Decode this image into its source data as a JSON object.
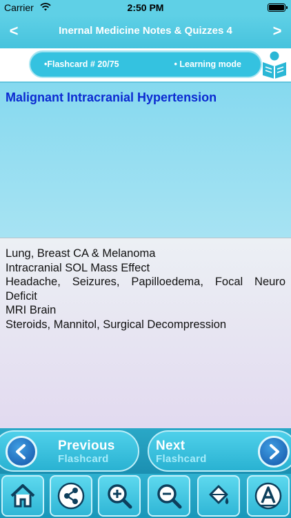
{
  "status_bar": {
    "carrier": "Carrier",
    "time": "2:50 PM"
  },
  "header": {
    "title": "Inernal Medicine Notes & Quizzes 4",
    "back_label": "<",
    "forward_label": ">"
  },
  "info_bar": {
    "flashcard_label": "•Flashcard #  20/75",
    "mode_label": "• Learning mode"
  },
  "question": {
    "text": "Malignant Intracranial Hypertension"
  },
  "answer": {
    "lines": [
      "Lung, Breast CA & Melanoma",
      "Intracranial SOL Mass Effect",
      "Headache, Seizures, Papilloedema, Focal Neuro Deficit",
      "MRI Brain",
      "Steroids, Mannitol, Surgical Decompression"
    ]
  },
  "nav_buttons": {
    "previous": {
      "line1": "Previous",
      "line2": "Flashcard"
    },
    "next": {
      "line1": "Next",
      "line2": "Flashcard"
    }
  },
  "toolbar": {
    "items": [
      {
        "icon": "home-icon"
      },
      {
        "icon": "share-icon"
      },
      {
        "icon": "zoom-in-icon"
      },
      {
        "icon": "zoom-out-icon"
      },
      {
        "icon": "paint-bucket-icon"
      },
      {
        "icon": "font-icon"
      }
    ]
  },
  "colors": {
    "accent": "#46c3dd",
    "question_text": "#0b2ad1",
    "nav_circle": "#1253a8"
  }
}
